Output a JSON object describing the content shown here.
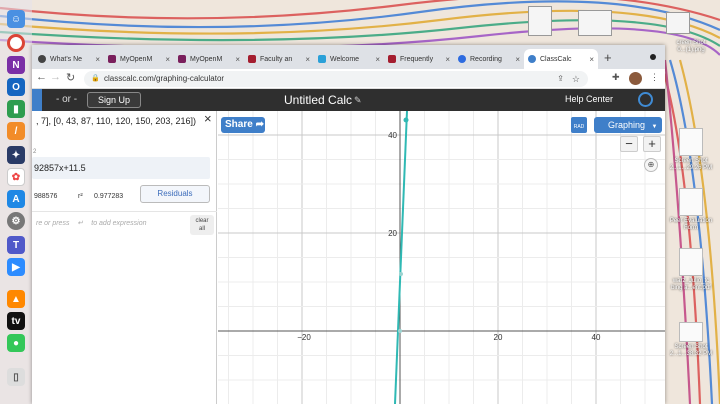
{
  "browser": {
    "tabs": [
      {
        "label": "What's Ne",
        "color": "#444"
      },
      {
        "label": "MyOpenM",
        "color": "#7a1f5c"
      },
      {
        "label": "MyOpenM",
        "color": "#7a1f5c"
      },
      {
        "label": "Faculty an",
        "color": "#a41d2f"
      },
      {
        "label": "Welcome",
        "color": "#2aa0d8"
      },
      {
        "label": "Frequently",
        "color": "#a41d2f"
      },
      {
        "label": "Recording",
        "color": "#2d6be0"
      },
      {
        "label": "ClassCalc",
        "color": "#3f7fc9"
      }
    ],
    "new_tab": "+",
    "url": "classcalc.com/graphing-calculator"
  },
  "header": {
    "or_text": "- or -",
    "signup": "Sign Up",
    "title": "Untitled Calc",
    "help": "Help Center"
  },
  "expressions": {
    "line1": ", 7], [0, 43, 87, 110, 120, 150, 203, 216])",
    "close": "×",
    "fn_label": "2",
    "regression": "92857x+11.5",
    "stat1": "988576",
    "stat2_label": "r²",
    "stat2": "0.977283",
    "residuals": "Residuals",
    "new_expr_hint": "re or press",
    "new_expr_hint2": "to add expression",
    "clear_all_line1": "clear",
    "clear_all_line2": "all"
  },
  "graph": {
    "share": "Share",
    "rad": "RAD",
    "graphing": "Graphing",
    "zoom_out": "−",
    "zoom_in": "+",
    "home": "⌂",
    "x_ticks": [
      "−20",
      "20",
      "40"
    ],
    "y_ticks": [
      "40",
      "20"
    ],
    "accent": "#3f7fc9",
    "line_color": "#2fb9b4"
  },
  "desktop": {
    "files": [
      {
        "label": "creen Shot\n0...(1).png"
      },
      {
        "label": "Screen Shot\n2...1...29.26 PM"
      },
      {
        "label": "Peer Evaluation\nForm"
      },
      {
        "label": "warz_Julio_tc\nbing a...ent.pdf"
      },
      {
        "label": "Screen Shot\n2...1...38.32 PM"
      }
    ]
  }
}
